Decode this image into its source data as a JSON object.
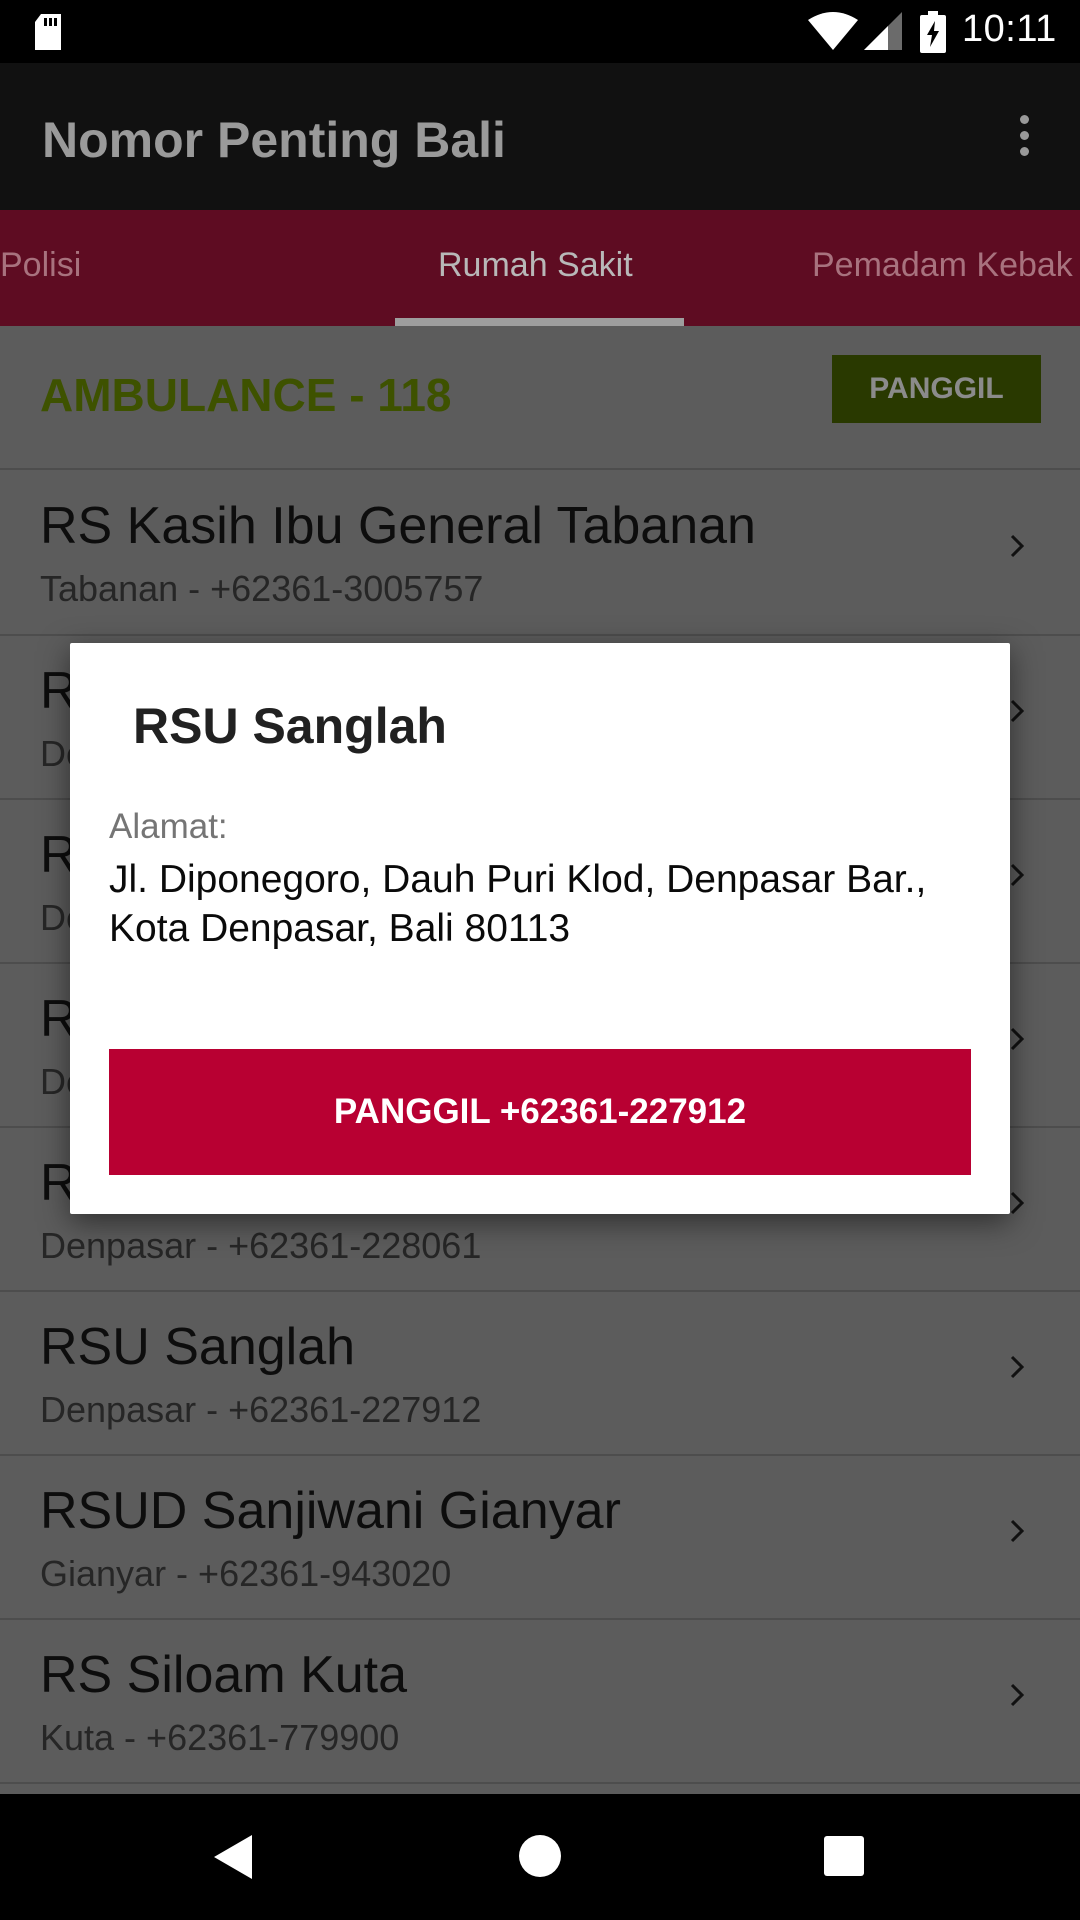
{
  "status_bar": {
    "time": "10:11",
    "icons": [
      "sd-card-icon",
      "wifi-icon",
      "cell-signal-icon",
      "battery-charging-icon"
    ]
  },
  "app_bar": {
    "title": "Nomor Penting Bali",
    "menu_icon": "overflow-menu-icon"
  },
  "tabs": [
    {
      "label": "Polisi"
    },
    {
      "label": "Rumah Sakit",
      "selected": true
    },
    {
      "label": "Pemadam Kebak"
    }
  ],
  "ambulance": {
    "label": "AMBULANCE - 118",
    "button_label": "PANGGIL"
  },
  "list": [
    {
      "name": "RS Kasih Ibu General Tabanan",
      "sub": "Tabanan - +62361-3005757"
    },
    {
      "name": "R",
      "sub": "De"
    },
    {
      "name": "R",
      "sub": "De"
    },
    {
      "name": "R",
      "sub": "De"
    },
    {
      "name": "R",
      "sub": "Denpasar - +62361-228061"
    },
    {
      "name": "RSU Sanglah",
      "sub": "Denpasar - +62361-227912"
    },
    {
      "name": "RSUD Sanjiwani Gianyar",
      "sub": "Gianyar - +62361-943020"
    },
    {
      "name": "RS Siloam Kuta",
      "sub": "Kuta - +62361-779900"
    }
  ],
  "dialog": {
    "title": "RSU Sanglah",
    "address_label": "Alamat:",
    "address": "Jl. Diponegoro, Dauh Puri Klod, Denpasar Bar., Kota Denpasar, Bali 80113",
    "call_button": "PANGGIL +62361-227912"
  },
  "nav_bar": {
    "icons": [
      "back-icon",
      "home-icon",
      "recents-icon"
    ]
  },
  "colors": {
    "tab_bar": "#5e0c22",
    "call_button": "#b80032",
    "ambulance_text": "#3e5200"
  }
}
